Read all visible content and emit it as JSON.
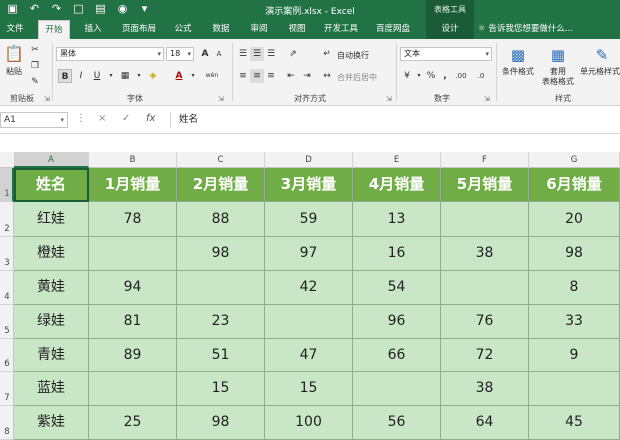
{
  "title_bar": {
    "document_title": "演示案例.xlsx - Excel",
    "context_title": "表格工具",
    "qat_icons": [
      "save-icon",
      "undo-icon",
      "redo-icon",
      "new-file-icon",
      "open-icon",
      "camera-icon",
      "customize-qat-icon"
    ]
  },
  "tabs": [
    {
      "label": "文件",
      "state": "normal"
    },
    {
      "label": "开始",
      "state": "active"
    },
    {
      "label": "插入",
      "state": "normal"
    },
    {
      "label": "页面布局",
      "state": "normal"
    },
    {
      "label": "公式",
      "state": "normal"
    },
    {
      "label": "数据",
      "state": "normal"
    },
    {
      "label": "审阅",
      "state": "normal"
    },
    {
      "label": "视图",
      "state": "normal"
    },
    {
      "label": "开发工具",
      "state": "normal"
    },
    {
      "label": "百度网盘",
      "state": "normal"
    },
    {
      "label": "设计",
      "state": "contextual"
    }
  ],
  "tell_me": "告诉我您想要做什么...",
  "ribbon": {
    "clipboard": {
      "paste_label": "粘贴",
      "group_label": "剪贴板"
    },
    "font": {
      "font_name": "黑体",
      "font_size": "18",
      "bold": "B",
      "italic": "I",
      "underline": "U",
      "font_color_glyph": "A",
      "grow": "A",
      "shrink": "A",
      "phonetic": "wén",
      "group_label": "字体"
    },
    "alignment": {
      "wrap_text": "自动换行",
      "merge_center": "合并后居中",
      "group_label": "对齐方式"
    },
    "number": {
      "format": "文本",
      "currency": "¥",
      "percent": "%",
      "comma": ",",
      "inc_decimal": ".00",
      "dec_decimal": ".0",
      "group_label": "数字"
    },
    "styles": {
      "conditional": "条件格式",
      "table_line1": "套用",
      "table_line2": "表格格式",
      "cell_styles": "单元格样式",
      "group_label": "样式"
    }
  },
  "formula_bar": {
    "name_box": "A1",
    "cancel_glyph": "×",
    "enter_glyph": "✓",
    "fx_glyph": "fx",
    "formula": "姓名"
  },
  "sheet": {
    "column_headers": [
      "A",
      "B",
      "C",
      "D",
      "E",
      "F",
      "G"
    ],
    "row_headers": [
      "1",
      "2",
      "3",
      "4",
      "5",
      "6",
      "7",
      "8"
    ],
    "header_row": [
      "姓名",
      "1月销量",
      "2月销量",
      "3月销量",
      "4月销量",
      "5月销量",
      "6月销量"
    ],
    "rows": [
      [
        "红娃",
        "78",
        "88",
        "59",
        "13",
        "",
        "20"
      ],
      [
        "橙娃",
        "",
        "98",
        "97",
        "16",
        "38",
        "98"
      ],
      [
        "黄娃",
        "94",
        "",
        "42",
        "54",
        "",
        "8"
      ],
      [
        "绿娃",
        "81",
        "23",
        "",
        "96",
        "76",
        "33"
      ],
      [
        "青娃",
        "89",
        "51",
        "47",
        "66",
        "72",
        "9"
      ],
      [
        "蓝娃",
        "",
        "15",
        "15",
        "",
        "38",
        ""
      ],
      [
        "紫娃",
        "25",
        "98",
        "100",
        "56",
        "64",
        "45"
      ]
    ],
    "active_cell": "A1"
  },
  "colors": {
    "excel_green": "#217346",
    "header_fill": "#70ad47",
    "body_fill": "#c9e7c6"
  }
}
